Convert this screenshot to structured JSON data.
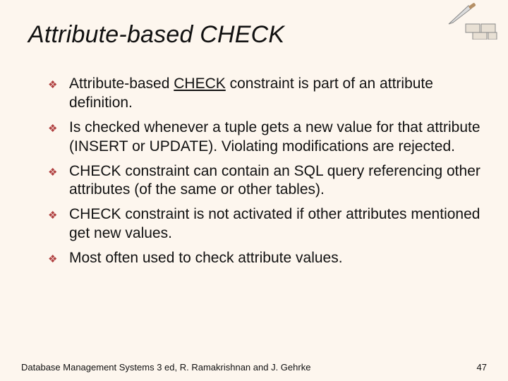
{
  "title": "Attribute-based CHECK",
  "bullets": [
    {
      "prefix": "Attribute-based ",
      "underlined": "CHECK",
      "suffix": " constraint is part of an attribute definition."
    },
    {
      "text": "Is checked whenever a tuple gets a new value for that attribute (INSERT or UPDATE). Violating modifications are rejected."
    },
    {
      "text": "CHECK constraint can contain an SQL query referencing other attributes (of the same or other tables)."
    },
    {
      "text": "CHECK constraint is not activated if other attributes mentioned get new values."
    },
    {
      "text": "Most often used to check attribute values."
    }
  ],
  "footer": {
    "source": "Database Management Systems 3 ed,  R. Ramakrishnan and J. Gehrke",
    "page": "47"
  },
  "icons": {
    "bullet": "❖",
    "clipart": "trowel-bricks"
  }
}
